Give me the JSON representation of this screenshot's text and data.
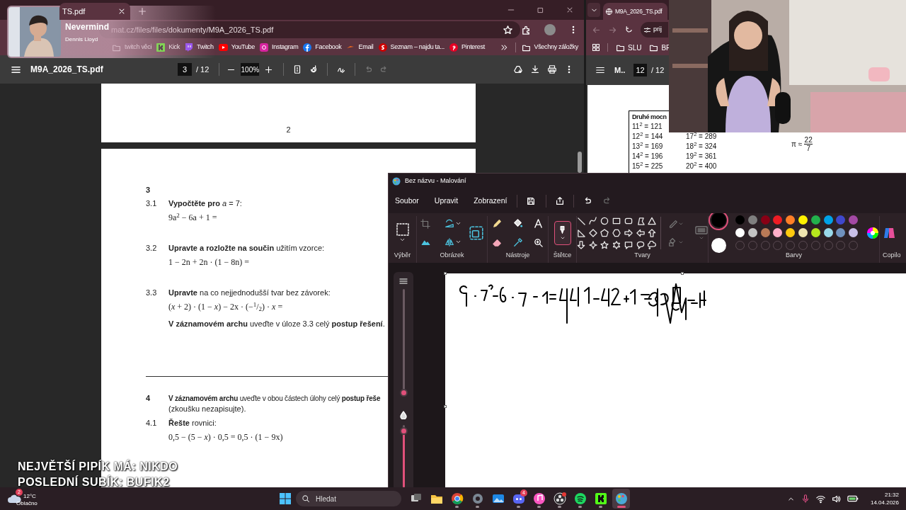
{
  "music_overlay": {
    "title": "Nevermind",
    "artist": "Dennis Lloyd"
  },
  "left_browser": {
    "tab_title": "TS.pdf",
    "url": "mat.cz/files/files/dokumenty/M9A_2026_TS.pdf",
    "bookmarks": [
      {
        "label": "twitch věci",
        "kind": "folder"
      },
      {
        "label": "Kick",
        "kind": "kick"
      },
      {
        "label": "Twitch",
        "kind": "twitch"
      },
      {
        "label": "YouTube",
        "kind": "youtube"
      },
      {
        "label": "Instagram",
        "kind": "instagram"
      },
      {
        "label": "Facebook",
        "kind": "facebook"
      },
      {
        "label": "Email",
        "kind": "email"
      },
      {
        "label": "Seznam – najdu ta...",
        "kind": "seznam"
      },
      {
        "label": "Pinterest",
        "kind": "pinterest"
      }
    ],
    "all_bookmarks": "Všechny záložky",
    "pdf": {
      "file_name": "M9A_2026_TS.pdf",
      "page": "3",
      "page_count": "/ 12",
      "zoom": "100%",
      "page_footer": "2",
      "section": "3",
      "tasks": [
        {
          "number": "3.1",
          "prompt": "**Vypočtěte pro** *a* = 7:",
          "expression": "9a$^{2}$ − 6a  + 1 ="
        },
        {
          "number": "3.2",
          "prompt": "**Upravte a rozložte na součin** užitím vzorce:",
          "expression": "1 − 2n + 2n · (1 − 8n) ="
        },
        {
          "number": "3.3",
          "prompt": "**Upravte** na co nejjednodušší tvar bez závorek:",
          "expression": "(*x* + 2) · (1 − *x*) − 2x · (−$^{1}$/$_{2}$) · *x* =",
          "note": "**V záznamovém archu** uveďte v úloze 3.3 celý **postup řešení**."
        }
      ],
      "section_2": {
        "number": "4",
        "instruction": "**V záznamovém archu** uveďte v obou částech úlohy celý **postup řeše**",
        "instruction_cont": "(zkoušku nezapisujte).",
        "tasks": [
          {
            "number": "4.1",
            "prompt": "**Řešte** rovnici:",
            "expression": "0,5 − (5 − *x*) · 0,5 = 0,5 · (1 − 9x)"
          }
        ]
      }
    }
  },
  "right_browser": {
    "tab_title": "M9A_2026_TS.pdf",
    "url": "prij",
    "bookmarks": [
      "SLU",
      "BP"
    ],
    "pdf": {
      "file_name": "M..",
      "page": "12",
      "page_count": "/ 12",
      "table_title": "Druhé mocn",
      "squares_col1": [
        "11$^{2}$ = 121",
        "12$^{2}$ = 144",
        "13$^{2}$ = 169",
        "14$^{2}$ = 196",
        "15$^{2}$ = 225"
      ],
      "squares_col2": [
        "17$^{2}$ = 289",
        "18$^{2}$ = 324",
        "19$^{2}$ = 361",
        "20$^{2}$ = 400"
      ],
      "pi": "π ≈",
      "pi_numerator": "22",
      "pi_denominator": "7"
    }
  },
  "paint": {
    "title": "Bez názvu - Malování",
    "menu": [
      "Soubor",
      "Upravit",
      "Zobrazení"
    ],
    "groups": [
      "Výběr",
      "Obrázek",
      "Nástroje",
      "Štětce",
      "Tvary",
      "Barvy",
      "Copilo"
    ],
    "brushes_selected": true,
    "current_colors": [
      {
        "color": "#000000",
        "selected": true
      },
      {
        "color": "#ffffff",
        "selected": false
      }
    ],
    "palette": [
      {
        "color": "#000000"
      },
      {
        "color": "#7f7f7f"
      },
      {
        "color": "#880015"
      },
      {
        "color": "#ed1c24"
      },
      {
        "color": "#ff7f27"
      },
      {
        "color": "#fff200"
      },
      {
        "color": "#22b14c"
      },
      {
        "color": "#00a2e8"
      },
      {
        "color": "#3f48cc"
      },
      {
        "color": "#a349a4"
      },
      {
        "color": "#ffffff"
      },
      {
        "color": "#c3c3c3"
      },
      {
        "color": "#b97a57"
      },
      {
        "color": "#ffaec9"
      },
      {
        "color": "#ffc90e"
      },
      {
        "color": "#efe4b0"
      },
      {
        "color": "#b5e61d"
      },
      {
        "color": "#99d9ea"
      },
      {
        "color": "#7092be"
      },
      {
        "color": "#c8bfe7"
      }
    ],
    "size_slider": {
      "level": 0.02
    },
    "opacity_slider": {
      "level": 0.9
    }
  },
  "stream_overlay": [
    "NEJVĚTŠÍ PIPÍK MÁ: NIKDO",
    "POSLEDNÍ SUBÍK: BUFIK2"
  ],
  "taskbar": {
    "weather": {
      "badge": "2",
      "temperature": "12°C",
      "condition": "Oblačno"
    },
    "search": "Hledat",
    "apps": [
      {
        "kind": "task-view",
        "running": false,
        "active": false
      },
      {
        "kind": "explorer",
        "running": false,
        "active": false
      },
      {
        "kind": "browser",
        "running": true,
        "active": false
      },
      {
        "kind": "settings",
        "running": true,
        "active": false
      },
      {
        "kind": "photos",
        "running": false,
        "active": false
      },
      {
        "kind": "chat",
        "running": true,
        "active": false,
        "badge": "4"
      },
      {
        "kind": "music",
        "running": true,
        "active": false
      },
      {
        "kind": "recorder",
        "running": true,
        "active": false
      },
      {
        "kind": "spotify",
        "running": true,
        "active": false
      },
      {
        "kind": "kick",
        "running": true,
        "active": false
      },
      {
        "kind": "paint",
        "running": true,
        "active": true
      }
    ],
    "time": "21:32",
    "date": "14.04.2026"
  }
}
